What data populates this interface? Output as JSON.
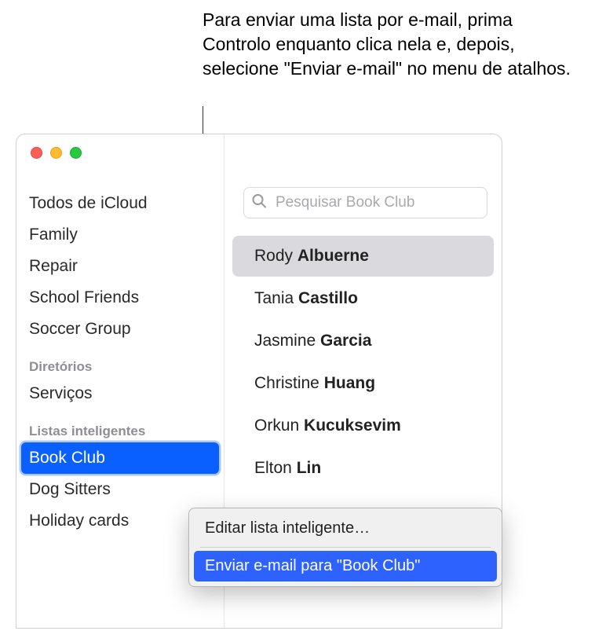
{
  "callout": {
    "text": "Para enviar uma lista por e-mail, prima Controlo enquanto clica nela e, depois, selecione \"Enviar e-mail\" no menu de atalhos."
  },
  "sidebar": {
    "groups": [
      "Todos de iCloud",
      "Family",
      "Repair",
      "School Friends",
      "Soccer Group"
    ],
    "directories_header": "Diretórios",
    "directories": [
      "Serviços"
    ],
    "smart_header": "Listas inteligentes",
    "smart_lists": [
      "Book Club",
      "Dog Sitters",
      "Holiday cards"
    ],
    "selected_smart": "Book Club"
  },
  "search": {
    "placeholder": "Pesquisar Book Club"
  },
  "contacts": [
    {
      "first": "Rody",
      "last": "Albuerne",
      "selected": true
    },
    {
      "first": "Tania",
      "last": "Castillo",
      "selected": false
    },
    {
      "first": "Jasmine",
      "last": "Garcia",
      "selected": false
    },
    {
      "first": "Christine",
      "last": "Huang",
      "selected": false
    },
    {
      "first": "Orkun",
      "last": "Kucuksevim",
      "selected": false
    },
    {
      "first": "Elton",
      "last": "Lin",
      "selected": false
    }
  ],
  "context_menu": {
    "edit_label": "Editar lista inteligente…",
    "send_label": "Enviar e-mail para \"Book Club\""
  }
}
